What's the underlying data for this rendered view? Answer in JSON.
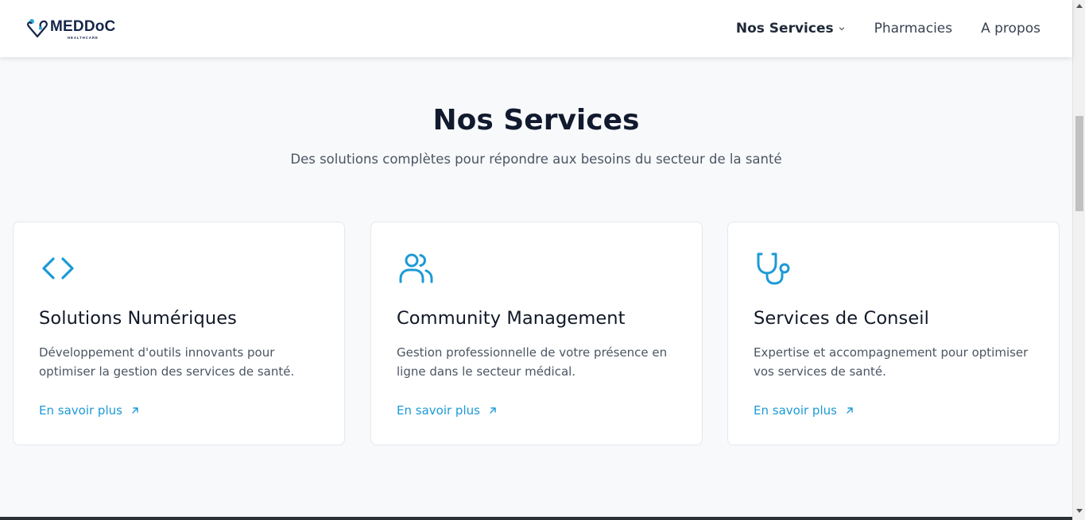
{
  "brand": {
    "name": "MEDDoC",
    "tagline": "HEALTHCARE"
  },
  "nav": {
    "items": [
      {
        "label": "Nos Services",
        "active": true,
        "has_dropdown": true
      },
      {
        "label": "Pharmacies",
        "active": false
      },
      {
        "label": "A propos",
        "active": false
      }
    ]
  },
  "section": {
    "title": "Nos Services",
    "subtitle": "Des solutions complètes pour répondre aux besoins du secteur de la santé"
  },
  "cards": [
    {
      "icon": "code-icon",
      "title": "Solutions Numériques",
      "text": "Développement d'outils innovants pour optimiser la gestion des services de santé.",
      "link": "En savoir plus"
    },
    {
      "icon": "users-icon",
      "title": "Community Management",
      "text": "Gestion professionnelle de votre présence en ligne dans le secteur médical.",
      "link": "En savoir plus"
    },
    {
      "icon": "stethoscope-icon",
      "title": "Services de Conseil",
      "text": "Expertise et accompagnement pour optimiser vos services de santé.",
      "link": "En savoir plus"
    }
  ],
  "colors": {
    "accent": "#1c9ad6",
    "brand_navy": "#15264a",
    "background": "#f8f9fb"
  }
}
